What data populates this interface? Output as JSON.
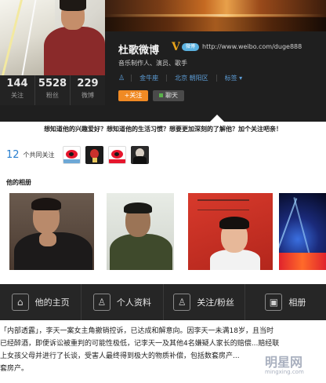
{
  "profile": {
    "name": "杜歌微博",
    "verify_mark": "V",
    "verify_badge": "微博",
    "url": "http://www.weibo.com/duge888",
    "intro": "音乐制作人、演员、歌手",
    "meta": {
      "person_icon": "person-icon",
      "company": "金牛座",
      "location": "北京 朝阳区",
      "tags": "标签 ▾"
    },
    "follow_button": "+关注",
    "chat_button": "聊天"
  },
  "stats": [
    {
      "num": "144",
      "label": "关注"
    },
    {
      "num": "5528",
      "label": "粉丝"
    },
    {
      "num": "229",
      "label": "微博"
    }
  ],
  "banner": "想知道他的兴趣爱好？想知道他的生活习惯？想要更加深刻的了解他？加个关注吧亲！",
  "common_follows": {
    "count": "12",
    "label": "个共同关注"
  },
  "album": {
    "title": "他的相册"
  },
  "nav": {
    "home": "他的主页",
    "profile": "个人资料",
    "follows": "关注/粉丝",
    "album": "相册"
  },
  "news": {
    "line1": "「内部透露」，李天一案女主角撤销控诉，已达成和解意向。因李天一未满18岁，且当时",
    "line2": "已经醉酒，即便诉讼被重判的可能性极低，记李天一及其他4名嫌疑人家长的赔偿...赔经联",
    "line3": "上女孩父母并进行了长谈，受害人最终得到极大的物质补偿，包括数套房产...",
    "line4": "套房产。"
  },
  "watermark": {
    "main": "明星网",
    "sub": "mingxing.com"
  },
  "colors": {
    "accent_orange": "#f08a24",
    "link_blue": "#5d9ed8",
    "count_blue": "#2a7fcf",
    "dark_bg": "#1f1f1f"
  }
}
